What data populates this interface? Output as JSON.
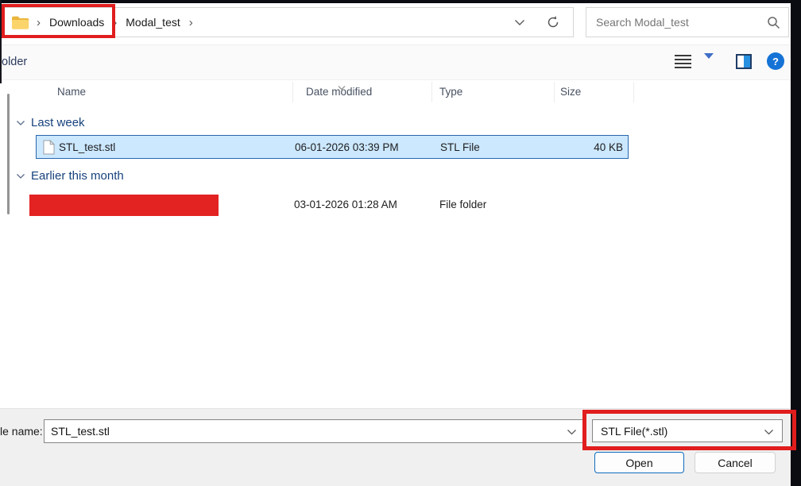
{
  "address_bar": {
    "breadcrumb": {
      "items": [
        "Downloads",
        "Modal_test"
      ]
    },
    "search": {
      "placeholder": "Search Modal_test"
    }
  },
  "toolbar": {
    "new_folder_label": "older"
  },
  "glyphs": {
    "breadcrumb_chevron": "›",
    "help": "?"
  },
  "list": {
    "columns": {
      "name": "Name",
      "date_modified": "Date modified",
      "type": "Type",
      "size": "Size"
    },
    "groups": [
      {
        "label": "Last week",
        "items": [
          {
            "name": "STL_test.stl",
            "date_modified": "06-01-2026 03:39 PM",
            "type": "STL File",
            "size": "40 KB",
            "selected": true
          }
        ]
      },
      {
        "label": "Earlier this month",
        "items": [
          {
            "name": "",
            "redacted": true,
            "date_modified": "03-01-2026 01:28 AM",
            "type": "File folder",
            "size": ""
          }
        ]
      }
    ]
  },
  "footer": {
    "file_name_label": "le name:",
    "file_name_value": "STL_test.stl",
    "file_type_selected": "STL File(*.stl)",
    "open_button": "Open",
    "cancel_button": "Cancel"
  },
  "colors": {
    "annotation_red": "#e11d1d",
    "selection_fill": "#cce8ff",
    "selection_border": "#2866ad",
    "help_icon_blue": "#1573d6",
    "group_header_text": "#16427c"
  }
}
